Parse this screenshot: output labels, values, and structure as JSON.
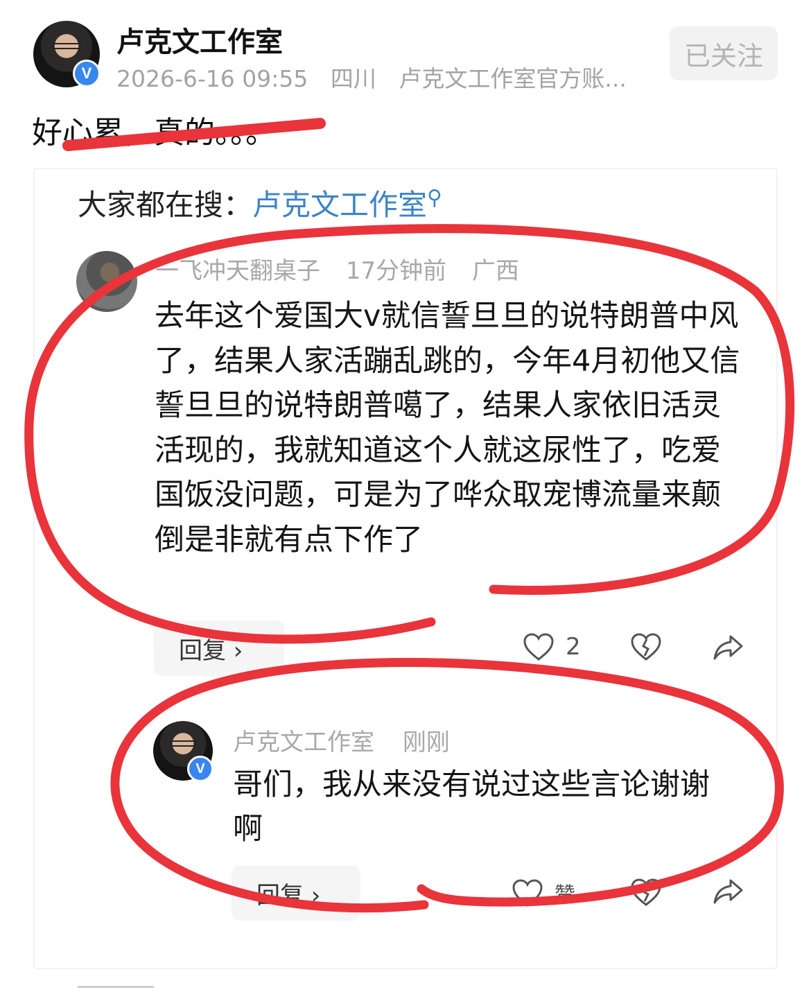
{
  "post": {
    "author": "卢克文工作室",
    "verified_badge": "V",
    "datetime": "2026-6-16 09:55",
    "location": "四川",
    "account_desc": "卢克文工作室官方账...",
    "follow_label": "已关注",
    "text": "好心累，真的。。。"
  },
  "search_hint": {
    "prefix": "大家都在搜：",
    "keyword": "卢克文工作室"
  },
  "comment": {
    "author": "一飞冲天翻桌子",
    "time": "17分钟前",
    "location": "广西",
    "text": "去年这个爱国大v就信誓旦旦的说特朗普中风了，结果人家活蹦乱跳的，今年4月初他又信誓旦旦的说特朗普噶了，结果人家依旧活灵活现的，我就知道这个人就这尿性了，吃爱国饭没问题，可是为了哗众取宠博流量来颠倒是非就有点下作了",
    "reply_label": "回复 ›",
    "like_count": "2"
  },
  "reply": {
    "author": "卢克文工作室",
    "verified_badge": "V",
    "time": "刚刚",
    "text": "哥们，我从来没有说过这些言论谢谢啊",
    "reply_label": "回复 ›",
    "like_label": "赞"
  },
  "icons": {
    "like": "heart-outline-icon",
    "dislike": "broken-heart-icon",
    "share": "share-arrow-icon",
    "search": "search-icon"
  },
  "colors": {
    "accent_blue": "#3c84c8",
    "verified_blue": "#3a86f0",
    "annotation_red": "#e8343a",
    "meta_gray": "#a3a3a3"
  }
}
